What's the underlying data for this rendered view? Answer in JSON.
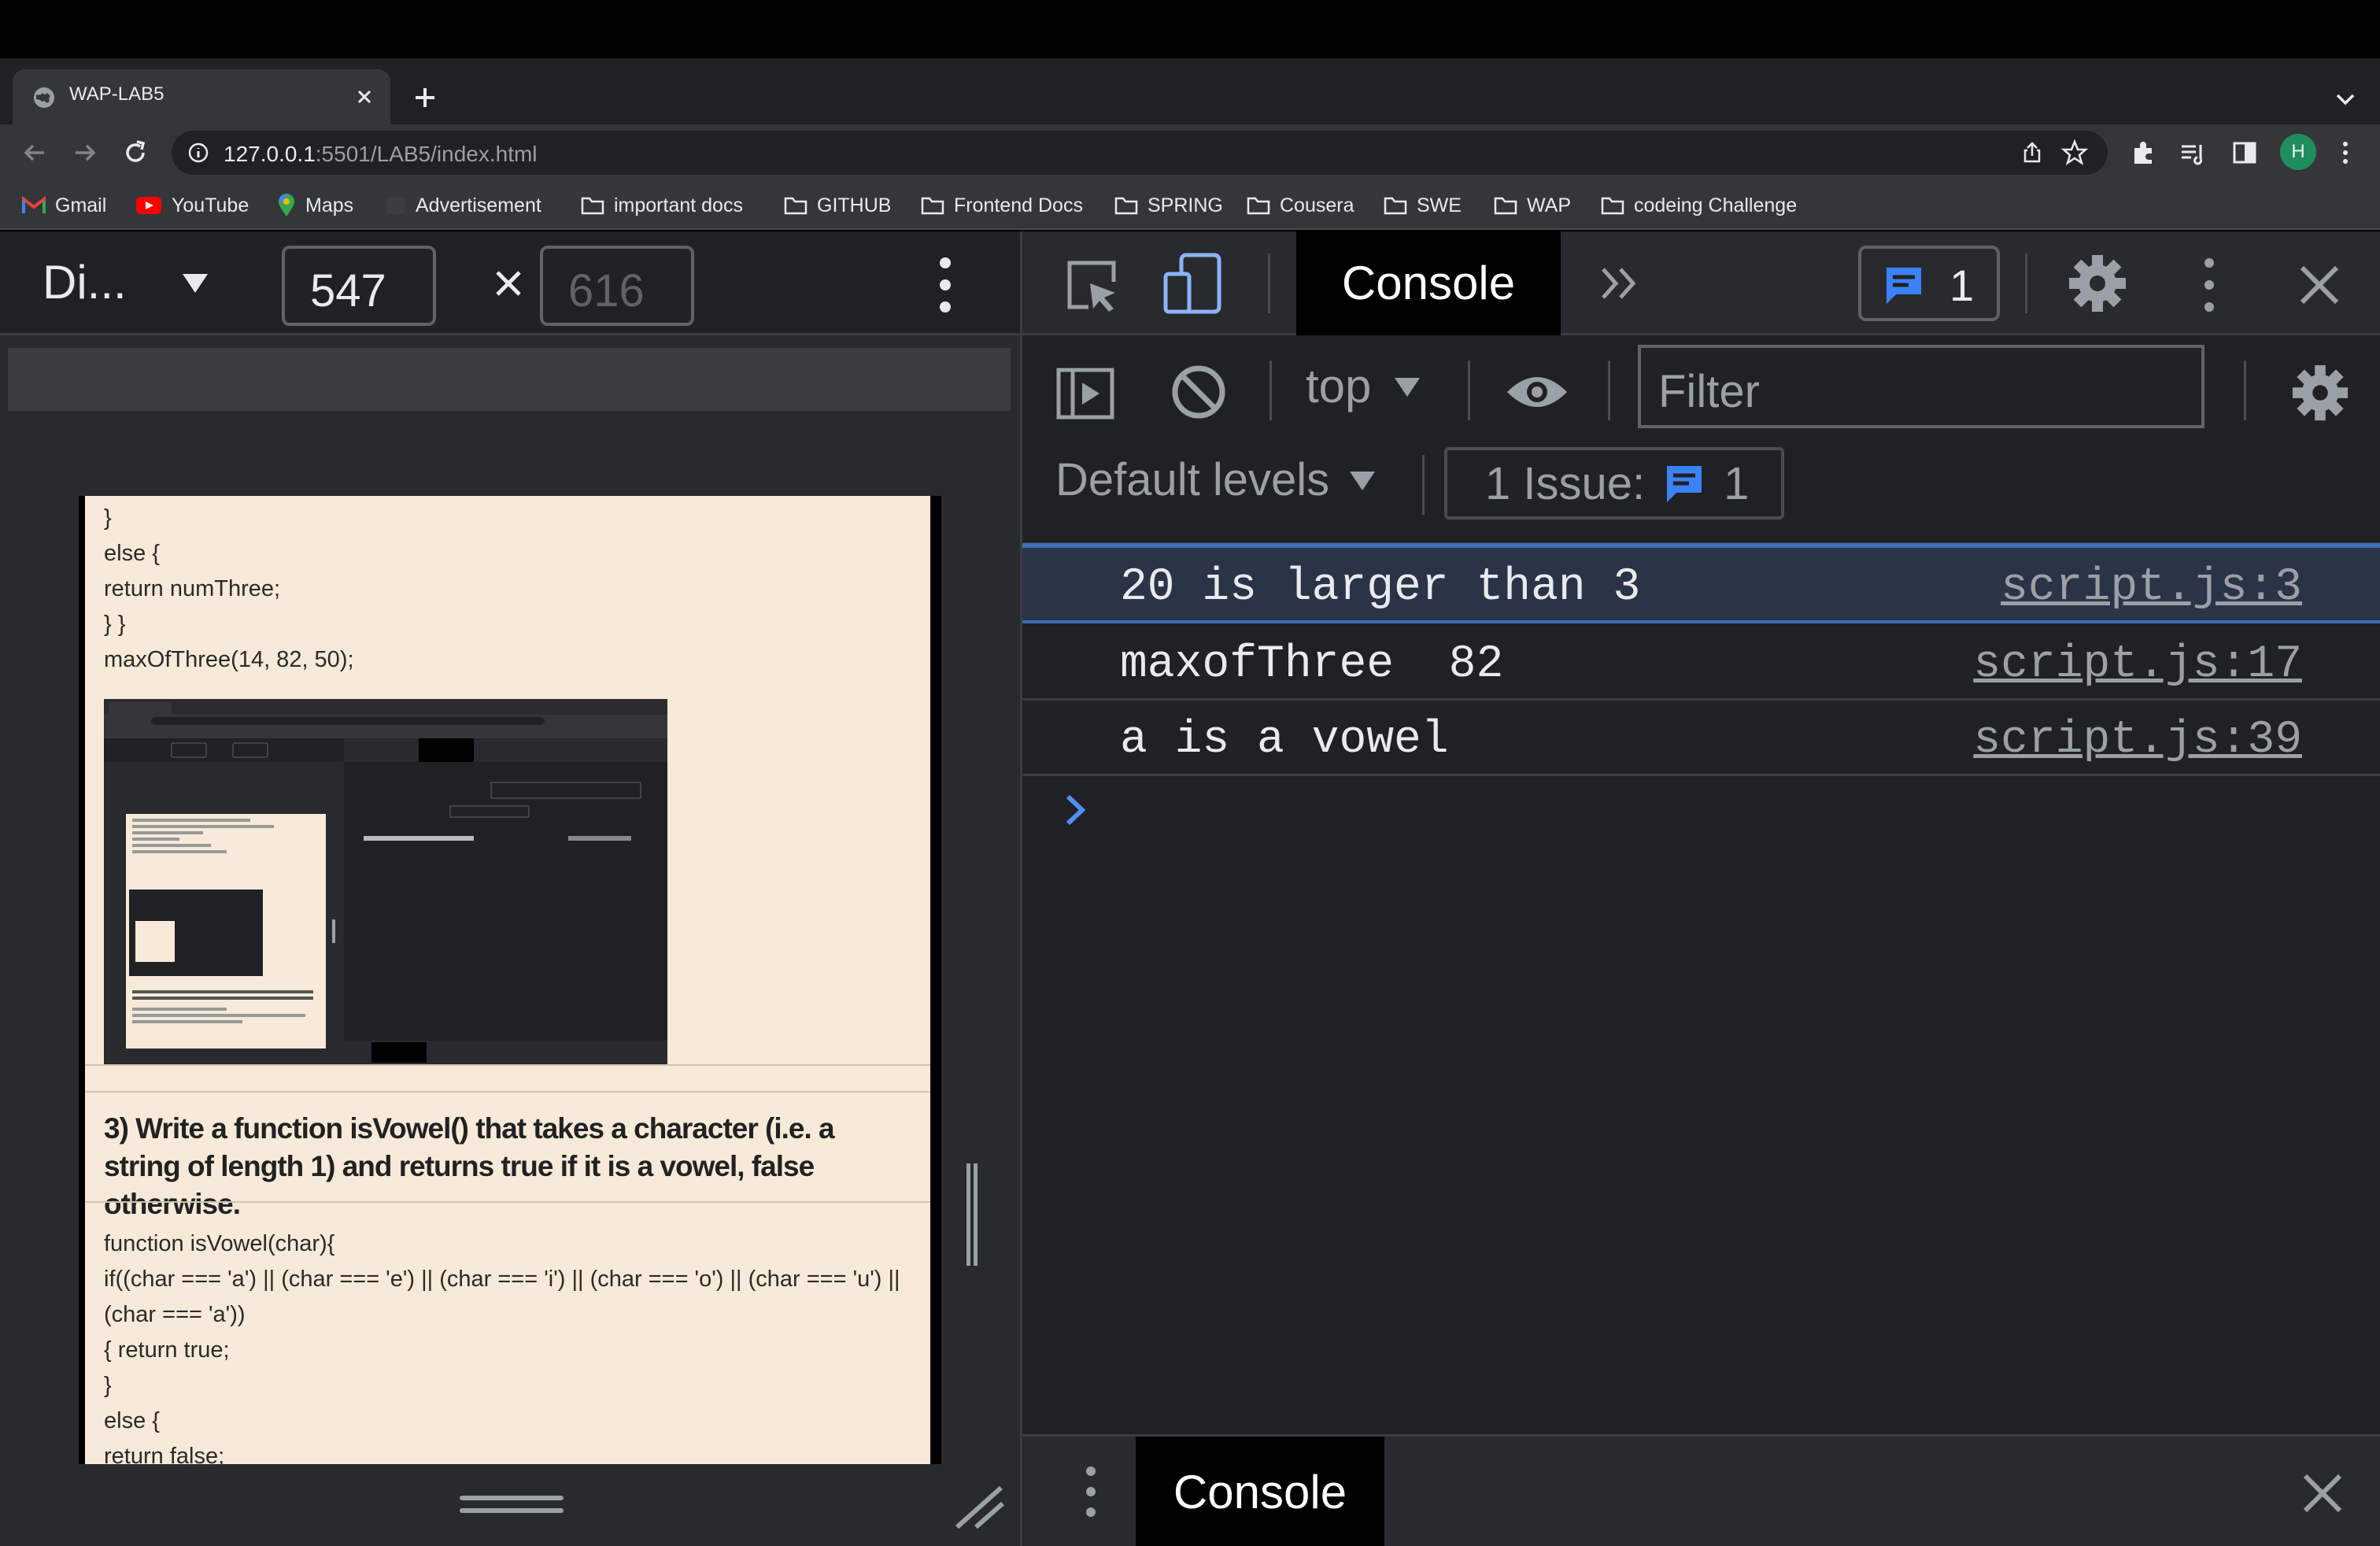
{
  "browser": {
    "tab": {
      "title": "WAP-LAB5",
      "icon": "globe-icon"
    },
    "url": {
      "host": "127.0.0.1",
      "rest": ":5501/LAB5/index.html"
    },
    "profile_initial": "H",
    "bookmarks": [
      {
        "label": "Gmail",
        "icon": "gmail-icon"
      },
      {
        "label": "YouTube",
        "icon": "youtube-icon"
      },
      {
        "label": "Maps",
        "icon": "maps-icon"
      },
      {
        "label": "Advertisement",
        "icon": "blank-page-icon"
      },
      {
        "label": "important docs",
        "icon": "folder-icon"
      },
      {
        "label": "GITHUB",
        "icon": "folder-icon"
      },
      {
        "label": "Frontend Docs",
        "icon": "folder-icon"
      },
      {
        "label": "SPRING",
        "icon": "folder-icon"
      },
      {
        "label": "Cousera",
        "icon": "folder-icon"
      },
      {
        "label": "SWE",
        "icon": "folder-icon"
      },
      {
        "label": "WAP",
        "icon": "folder-icon"
      },
      {
        "label": "codeing Challenge",
        "icon": "folder-icon"
      }
    ]
  },
  "device_toolbar": {
    "device": "Di...",
    "width": "547",
    "height": "616",
    "times": "×"
  },
  "page": {
    "code_top": [
      "}",
      "else {",
      "return numThree;",
      "} }",
      "maxOfThree(14, 82, 50);"
    ],
    "question": "3) Write a function isVowel() that takes a character (i.e. a string of length 1) and returns true if it is a vowel, false otherwise.",
    "code_bottom": [
      "function isVowel(char){",
      "if((char === 'a') || (char === 'e') || (char === 'i') || (char === 'o') || (char === 'u') || (char === 'a'))",
      "{ return true;",
      "}",
      "else {",
      "return false;"
    ]
  },
  "devtools": {
    "active_tab": "Console",
    "issues_badge_count": "1",
    "context": "top",
    "filter_placeholder": "Filter",
    "levels": "Default levels",
    "issues_label": "1 Issue:",
    "issues_count": "1",
    "messages": [
      {
        "text": "20 is larger than 3",
        "source": "script.js:3"
      },
      {
        "text": "maxofThree  82",
        "source": "script.js:17"
      },
      {
        "text": "a is a vowel",
        "source": "script.js:39"
      }
    ],
    "drawer_tab": "Console"
  },
  "colors": {
    "accent": "#3b6fb6",
    "page_bg": "#f7ead8",
    "devtools_bg": "#202124",
    "avatar": "#1e8e5e"
  }
}
